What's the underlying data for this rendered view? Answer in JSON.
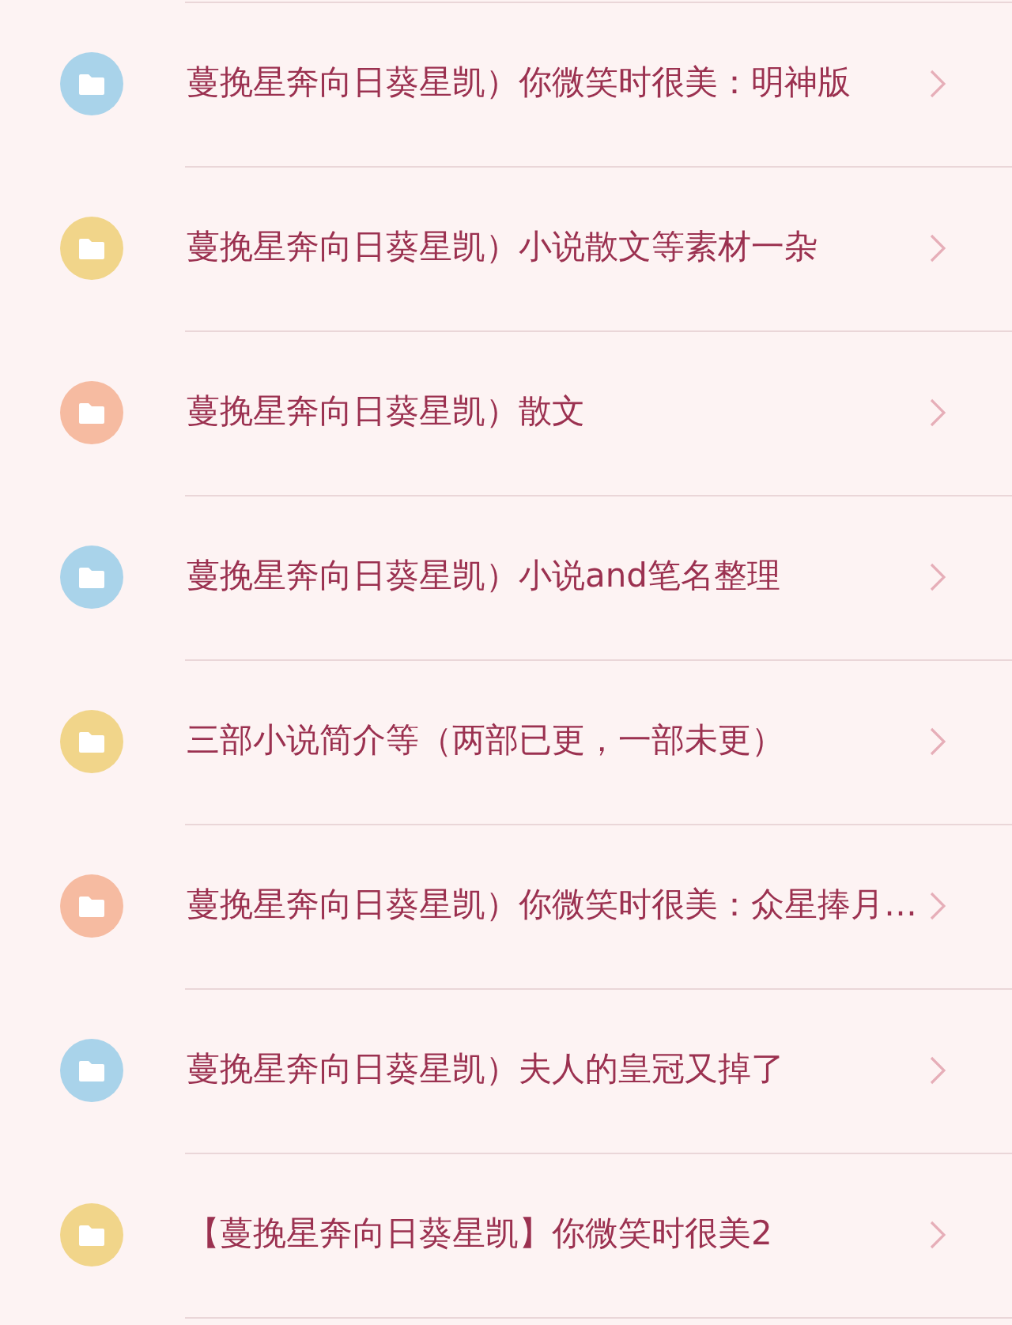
{
  "folders": [
    {
      "name": "蔓挽星奔向日葵星凯）你微笑时很美：明神版",
      "color": "#a9d3ea"
    },
    {
      "name": "蔓挽星奔向日葵星凯）小说散文等素材一杂",
      "color": "#f1d58a"
    },
    {
      "name": "蔓挽星奔向日葵星凯）散文",
      "color": "#f6bba1"
    },
    {
      "name": "蔓挽星奔向日葵星凯）小说and笔名整理",
      "color": "#a9d3ea"
    },
    {
      "name": "三部小说简介等（两部已更，一部未更）",
      "color": "#f1d58a"
    },
    {
      "name": "蔓挽星奔向日葵星凯）你微笑时很美：众星捧月…",
      "color": "#f6bba1"
    },
    {
      "name": "蔓挽星奔向日葵星凯）夫人的皇冠又掉了",
      "color": "#a9d3ea"
    },
    {
      "name": "【蔓挽星奔向日葵星凯】你微笑时很美2",
      "color": "#f1d58a"
    }
  ]
}
